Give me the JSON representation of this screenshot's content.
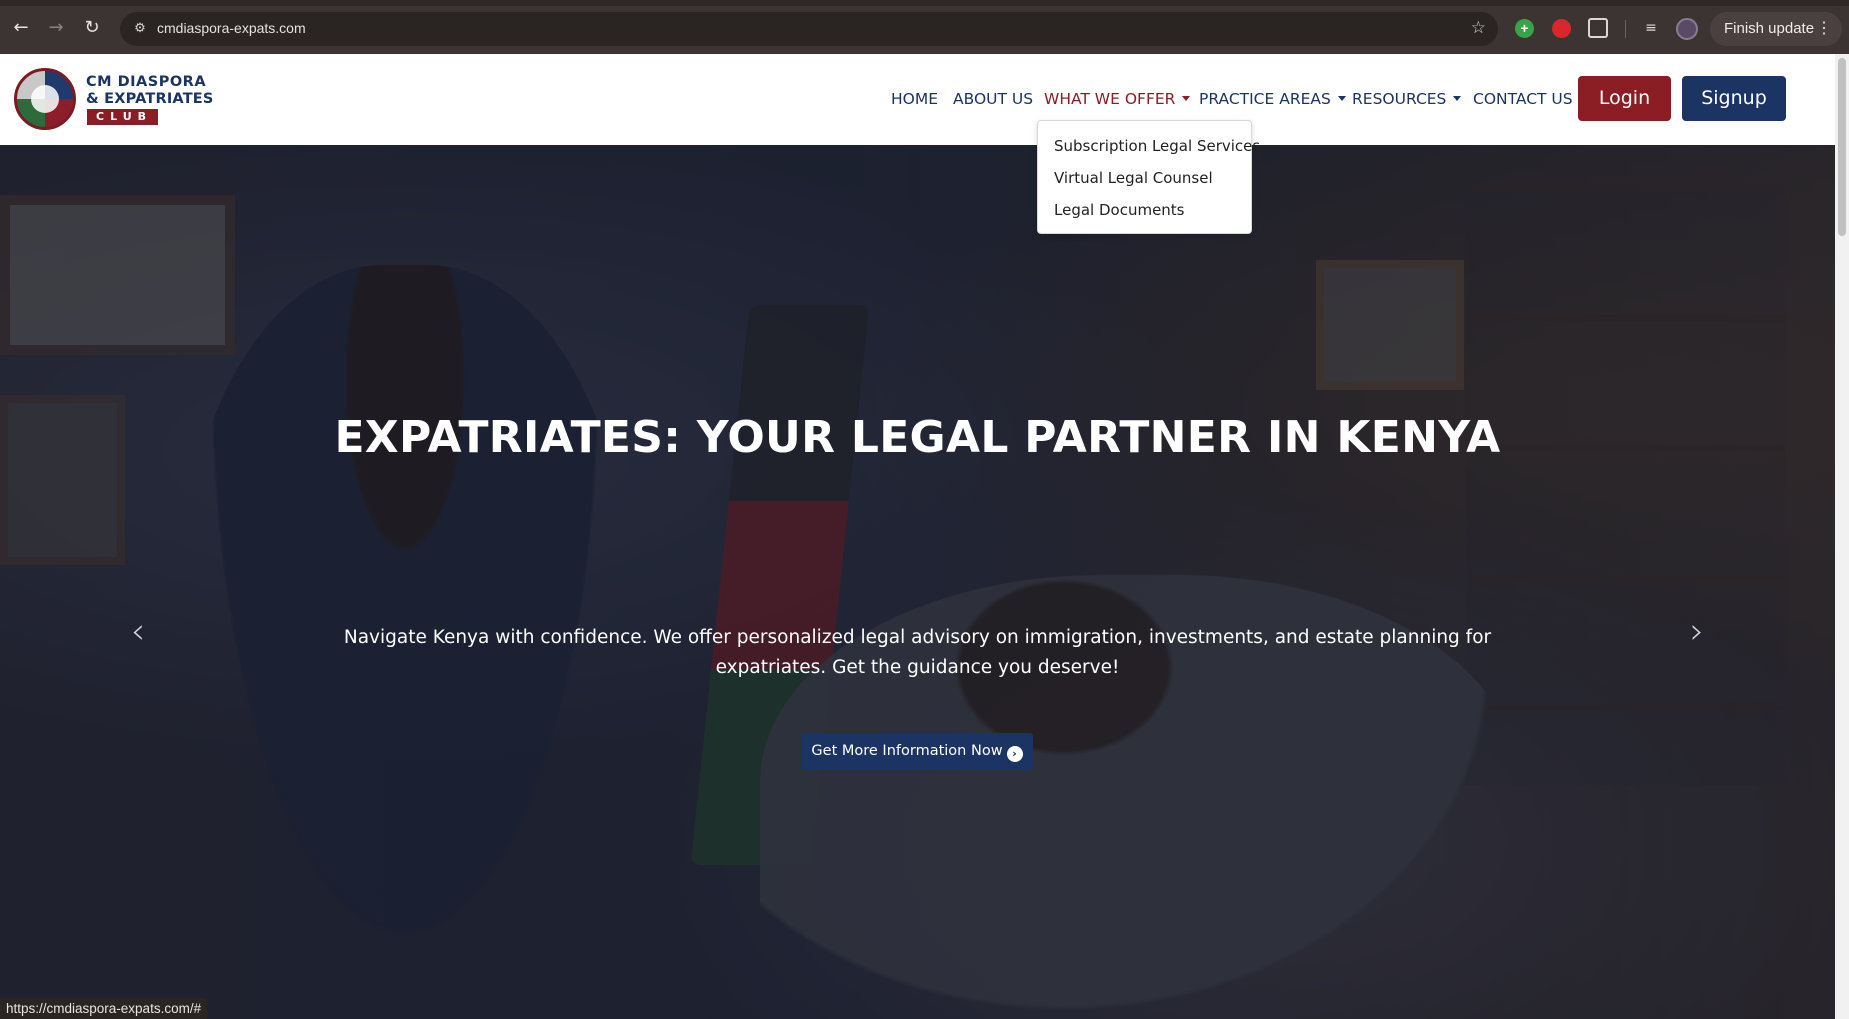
{
  "browser": {
    "url": "cmdiaspora-expats.com",
    "update_button_label": "Finish update",
    "status_url": "https://cmdiaspora-expats.com/#"
  },
  "logo": {
    "line1": "CM DIASPORA",
    "line2": "& EXPATRIATES",
    "line3": "CLUB"
  },
  "nav": {
    "home": "HOME",
    "about": "ABOUT US",
    "what_we_offer": "WHAT WE OFFER",
    "practice_areas": "PRACTICE AREAS",
    "resources": "RESOURCES",
    "contact": "CONTACT US",
    "login": "Login",
    "signup": "Signup"
  },
  "dropdown": {
    "items": [
      "Subscription Legal Services",
      "Virtual Legal Counsel",
      "Legal Documents"
    ]
  },
  "hero": {
    "title": "EXPATRIATES: YOUR LEGAL PARTNER IN KENYA",
    "subtitle": "Navigate Kenya with confidence. We offer personalized legal advisory on immigration, investments, and estate planning for expatriates. Get the guidance you deserve!",
    "cta_label": "Get More Information Now"
  },
  "colors": {
    "brand_navy": "#1c3463",
    "brand_red": "#8b1e24"
  },
  "icons": {
    "back": "arrow-left-icon",
    "forward": "arrow-right-icon",
    "reload": "reload-icon",
    "bookmark": "star-icon",
    "carousel_prev": "chevron-left-icon",
    "carousel_next": "chevron-right-icon",
    "cta": "arrow-circle-right-icon"
  }
}
